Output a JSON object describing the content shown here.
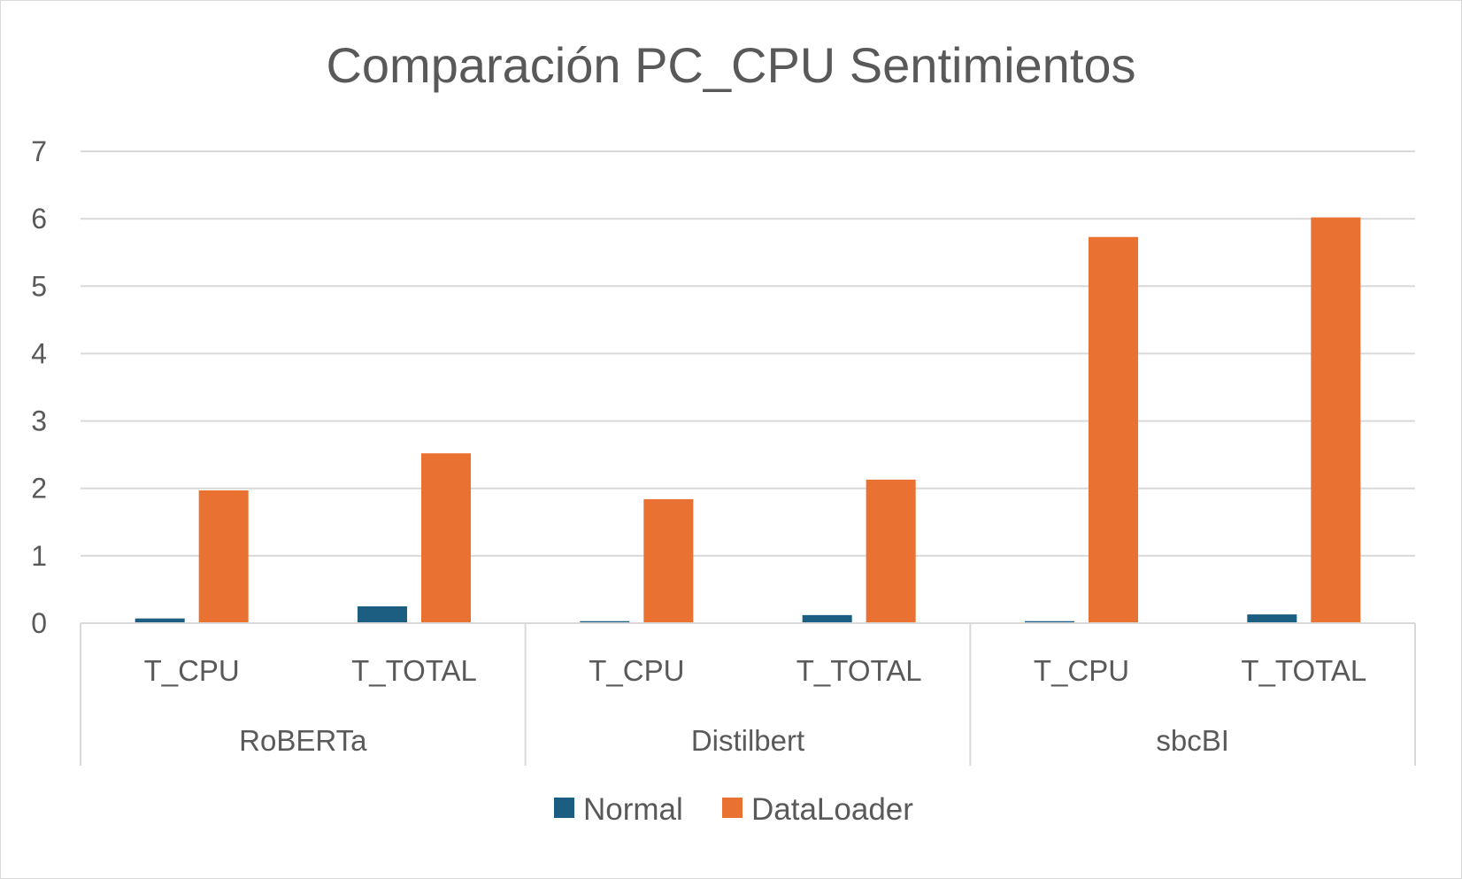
{
  "chart_data": {
    "type": "bar",
    "title": "Comparación PC_CPU Sentimientos",
    "xlabel": "",
    "ylabel": "",
    "ylim": [
      0,
      7
    ],
    "yticks": [
      0,
      1,
      2,
      3,
      4,
      5,
      6,
      7
    ],
    "grid": true,
    "legend_position": "bottom",
    "groups": [
      "RoBERTa",
      "Distilbert",
      "sbcBI"
    ],
    "categories": [
      "T_CPU",
      "T_TOTAL",
      "T_CPU",
      "T_TOTAL",
      "T_CPU",
      "T_TOTAL"
    ],
    "series": [
      {
        "name": "Normal",
        "color": "#1b5e82",
        "values": [
          0.07,
          0.25,
          0.03,
          0.12,
          0.03,
          0.13
        ]
      },
      {
        "name": "DataLoader",
        "color": "#e97132",
        "values": [
          1.97,
          2.52,
          1.84,
          2.13,
          5.73,
          6.02
        ]
      }
    ]
  }
}
